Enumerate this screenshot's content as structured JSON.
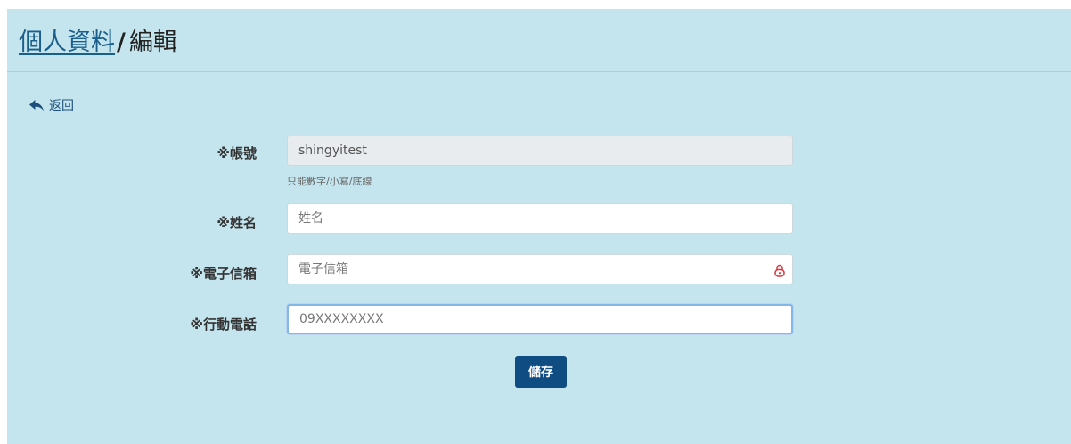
{
  "header": {
    "breadcrumb_link": "個人資料",
    "separator": "/",
    "current": "編輯"
  },
  "back": {
    "label": "返回",
    "icon": "reply-arrow-icon"
  },
  "form": {
    "account": {
      "label": "※帳號",
      "value": "shingyitest",
      "help": "只能數字/小寫/底線"
    },
    "name": {
      "label": "※姓名",
      "placeholder": "姓名"
    },
    "email": {
      "label": "※電子信箱",
      "placeholder": "電子信箱",
      "icon": "lock-icon"
    },
    "phone": {
      "label": "※行動電話",
      "placeholder": "09XXXXXXXX"
    },
    "save_label": "儲存"
  },
  "colors": {
    "panel_bg": "#c4e5ee",
    "primary": "#0f4c81",
    "lock_icon": "#d9363e"
  }
}
